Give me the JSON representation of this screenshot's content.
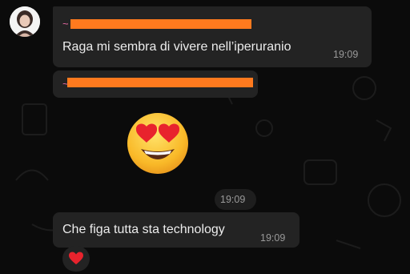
{
  "messages": [
    {
      "sender": "~",
      "text": "Raga mi sembra di vivere nell’iperuranio",
      "time": "19:09"
    },
    {
      "sender": "~",
      "sticker": "heart-eyes-emoji",
      "time": "19:09"
    },
    {
      "text": "Che figa tutta sta technology",
      "time": "19:09",
      "reaction": "heart-emoji"
    }
  ],
  "colors": {
    "background": "#0b0b0b",
    "bubble": "#232323",
    "sender_name": "#e86aa6",
    "redaction": "#ff7a1e",
    "message_text": "#ececec",
    "timestamp": "#9a9a9a"
  }
}
